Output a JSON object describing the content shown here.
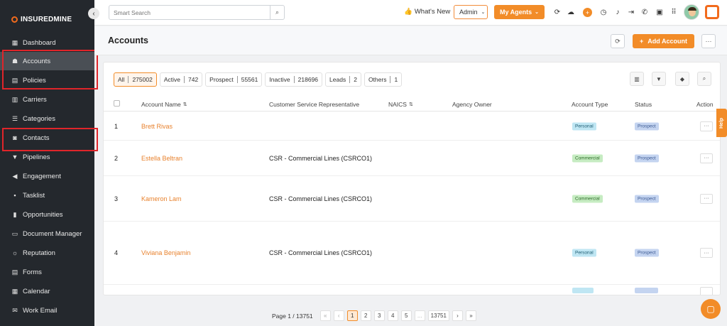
{
  "brand": {
    "name": "INSUREDMINE",
    "collapse_icon": "chevron-left-icon"
  },
  "sidebar": {
    "items": [
      {
        "label": "Dashboard",
        "icon": "dashboard-icon",
        "glyph": "▦"
      },
      {
        "label": "Accounts",
        "icon": "accounts-icon",
        "glyph": "☗"
      },
      {
        "label": "Policies",
        "icon": "policies-icon",
        "glyph": "▤"
      },
      {
        "label": "Carriers",
        "icon": "carriers-icon",
        "glyph": "▥"
      },
      {
        "label": "Categories",
        "icon": "categories-icon",
        "glyph": "☰"
      },
      {
        "label": "Contacts",
        "icon": "contacts-icon",
        "glyph": "◙"
      },
      {
        "label": "Pipelines",
        "icon": "pipelines-icon",
        "glyph": "▼"
      },
      {
        "label": "Engagement",
        "icon": "engagement-icon",
        "glyph": "◀"
      },
      {
        "label": "Tasklist",
        "icon": "tasklist-icon",
        "glyph": "▪"
      },
      {
        "label": "Opportunities",
        "icon": "opportunities-icon",
        "glyph": "▮"
      },
      {
        "label": "Document Manager",
        "icon": "folder-icon",
        "glyph": "▭"
      },
      {
        "label": "Reputation",
        "icon": "reputation-icon",
        "glyph": "☼"
      },
      {
        "label": "Forms",
        "icon": "forms-icon",
        "glyph": "▤"
      },
      {
        "label": "Calendar",
        "icon": "calendar-icon",
        "glyph": "▦"
      },
      {
        "label": "Work Email",
        "icon": "mail-icon",
        "glyph": "✉"
      }
    ]
  },
  "topbar": {
    "search_placeholder": "Smart Search",
    "whats_new": "What's New",
    "admin": "Admin",
    "my_agents": "My Agents"
  },
  "header": {
    "title": "Accounts",
    "add_label": "Add Account"
  },
  "filters": [
    {
      "label": "All",
      "count": "275002",
      "active": true
    },
    {
      "label": "Active",
      "count": "742"
    },
    {
      "label": "Prospect",
      "count": "55561"
    },
    {
      "label": "Inactive",
      "count": "218696"
    },
    {
      "label": "Leads",
      "count": "2"
    },
    {
      "label": "Others",
      "count": "1"
    }
  ],
  "columns": {
    "account_name": "Account Name",
    "csr": "Customer Service Representative",
    "naics": "NAICS",
    "agency_owner": "Agency Owner",
    "account_type": "Account Type",
    "status": "Status",
    "action": "Action"
  },
  "rows": [
    {
      "num": "1",
      "name": "Brett Rivas",
      "csr": "",
      "type": "Personal",
      "status": "Prospect"
    },
    {
      "num": "2",
      "name": "Estella Beltran",
      "csr": "CSR - Commercial Lines (CSRCO1)",
      "type": "Commercial",
      "status": "Prospect"
    },
    {
      "num": "3",
      "name": "Kameron Lam",
      "csr": "CSR - Commercial Lines (CSRCO1)",
      "type": "Commercial",
      "status": "Prospect"
    },
    {
      "num": "4",
      "name": "Viviana Benjamin",
      "csr": "CSR - Commercial Lines (CSRCO1)",
      "type": "Personal",
      "status": "Prospect"
    }
  ],
  "pagination": {
    "label": "Page 1 / 13751",
    "pages": [
      "1",
      "2",
      "3",
      "4",
      "5",
      "...",
      "13751"
    ],
    "first": "«",
    "prev": "‹",
    "next": "›",
    "last": "»"
  },
  "help": "Help",
  "colors": {
    "accent": "#f28c28",
    "sidebar": "#24282d",
    "highlight": "#e0252a"
  }
}
